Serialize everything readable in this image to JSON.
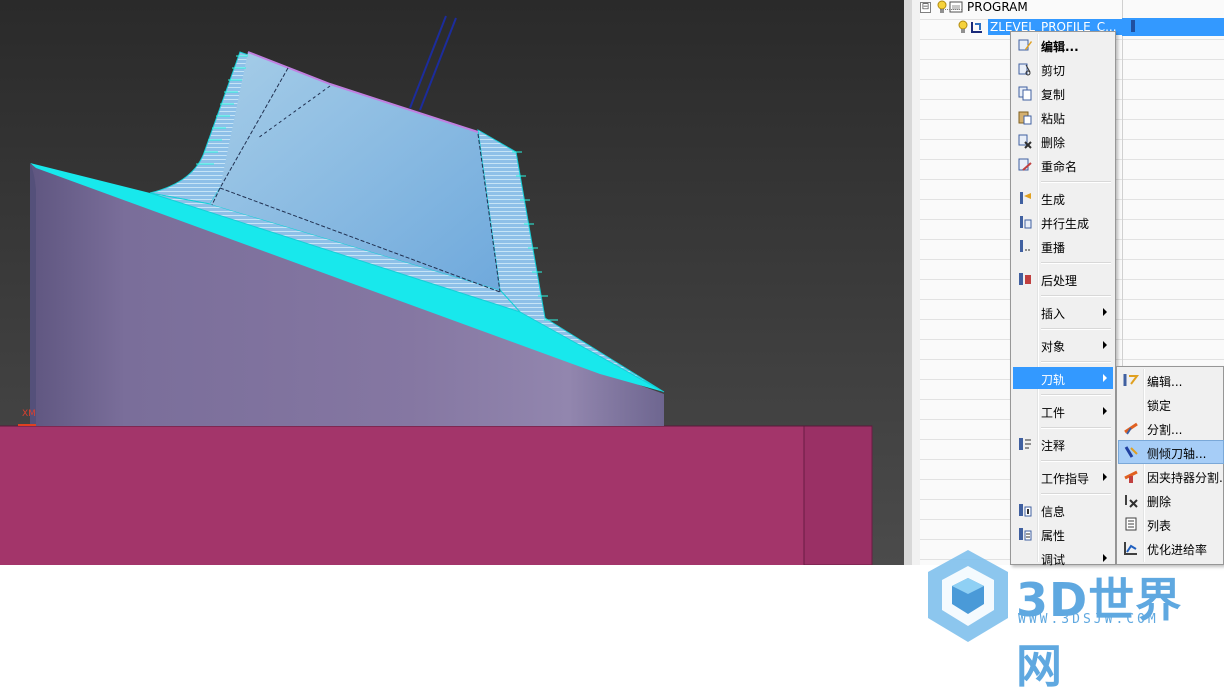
{
  "viewport": {
    "axis_label": "XM",
    "colors": {
      "background_top": "#2b2b2b",
      "background_bottom": "#4a4a4a",
      "part": "#8675a0",
      "fixture": "#a3356a",
      "toolpath": "#00ffff",
      "tool": "#1c2c8c"
    }
  },
  "tree": {
    "root": {
      "label": "PROGRAM",
      "expander": "⊟"
    },
    "operation": {
      "label": "ZLEVEL_PROFILE_C..."
    }
  },
  "context_menu": {
    "items": [
      {
        "label": "编辑...",
        "icon": "edit-icon"
      },
      {
        "label": "剪切",
        "icon": "cut-icon"
      },
      {
        "label": "复制",
        "icon": "copy-icon"
      },
      {
        "label": "粘贴",
        "icon": "paste-icon"
      },
      {
        "label": "删除",
        "icon": "delete-icon"
      },
      {
        "label": "重命名",
        "icon": "rename-icon"
      },
      {
        "label": "生成",
        "icon": "generate-icon"
      },
      {
        "label": "并行生成",
        "icon": "parallel-generate-icon"
      },
      {
        "label": "重播",
        "icon": "replay-icon"
      },
      {
        "label": "后处理",
        "icon": "postprocess-icon"
      },
      {
        "label": "插入"
      },
      {
        "label": "对象"
      },
      {
        "label": "刀轨"
      },
      {
        "label": "工件"
      },
      {
        "label": "注释",
        "icon": "comment-icon"
      },
      {
        "label": "工作指导"
      },
      {
        "label": "信息",
        "icon": "info-icon"
      },
      {
        "label": "属性",
        "icon": "properties-icon"
      },
      {
        "label": "调试"
      }
    ]
  },
  "toolpath_submenu": {
    "items": [
      {
        "label": "编辑...",
        "icon": "edit-path-icon"
      },
      {
        "label": "锁定"
      },
      {
        "label": "分割...",
        "icon": "split-icon"
      },
      {
        "label": "侧倾刀轴...",
        "icon": "tilt-axis-icon"
      },
      {
        "label": "因夹持器分割...",
        "icon": "holder-split-icon"
      },
      {
        "label": "删除",
        "icon": "delete-path-icon"
      },
      {
        "label": "列表",
        "icon": "list-icon"
      },
      {
        "label": "优化进给率",
        "icon": "optimize-feed-icon"
      }
    ]
  },
  "watermark": {
    "title": "3D世界网",
    "url": "WWW.3DSJW.COM",
    "color": "#5fa8e0"
  }
}
